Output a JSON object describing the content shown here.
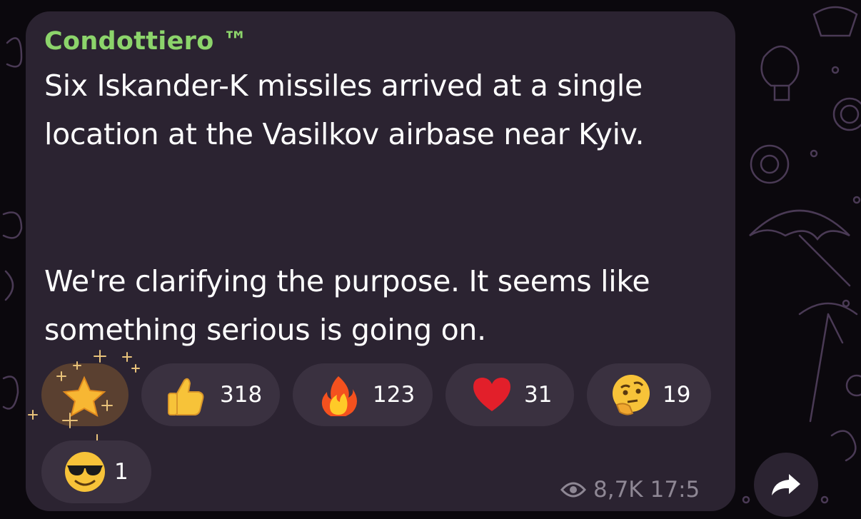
{
  "message": {
    "sender": "Condottiero ™",
    "paragraphs": [
      "Six Iskander-K missiles arrived at a single location at the Vasilkov airbase near Kyiv.",
      "We're clarifying the purpose. It seems like something serious is going on."
    ]
  },
  "reactions": [
    {
      "emoji": "star-sparkle-icon",
      "count": ""
    },
    {
      "emoji": "thumbs-up-icon",
      "count": "318"
    },
    {
      "emoji": "fire-icon",
      "count": "123"
    },
    {
      "emoji": "heart-icon",
      "count": "31"
    },
    {
      "emoji": "thinking-face-icon",
      "count": "19"
    },
    {
      "emoji": "sunglasses-face-icon",
      "count": "1"
    }
  ],
  "footer": {
    "views": "8,7K",
    "time": "17:5"
  },
  "colors": {
    "background": "#0b080d",
    "bubble": "#2b2331",
    "sender": "#8cd46b",
    "reaction_pill": "#3a3140",
    "meta": "#8e8794"
  }
}
